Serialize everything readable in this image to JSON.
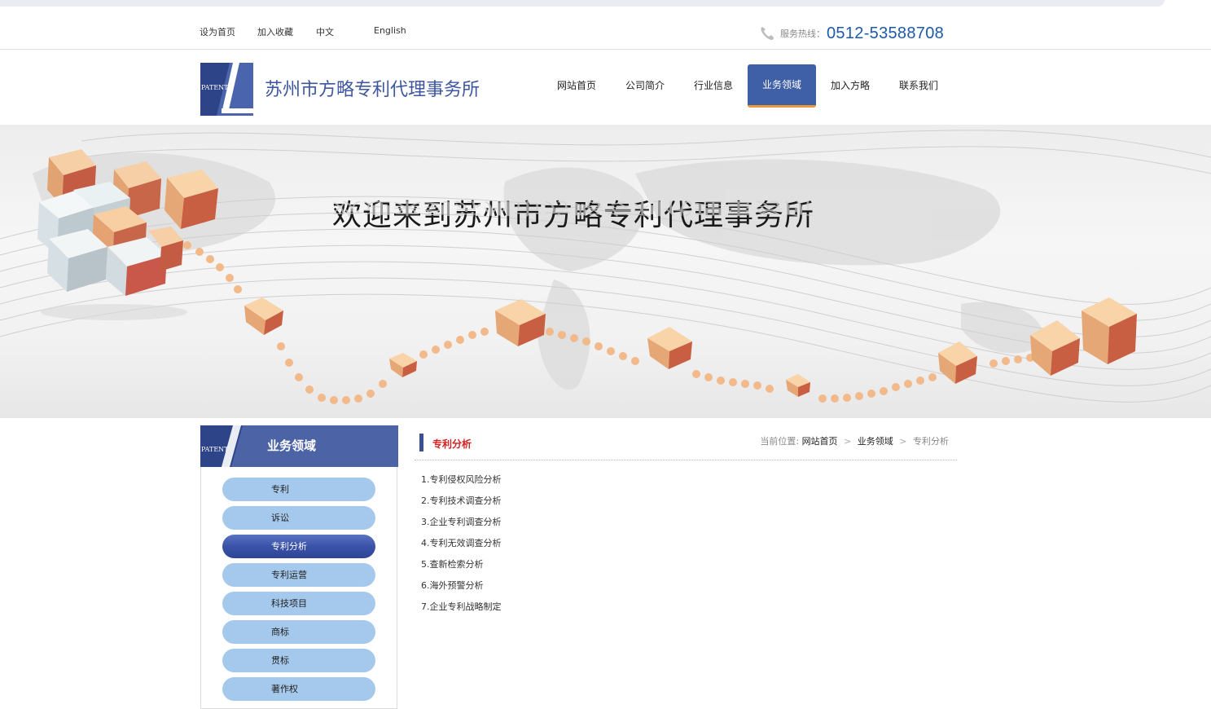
{
  "top_links": [
    "设为首页",
    "加入收藏",
    "中文",
    "English"
  ],
  "hotline": {
    "label": "服务热线：",
    "number": "0512-53588708"
  },
  "site_name": "苏州市方略专利代理事务所",
  "logo_text": "PATENT",
  "nav": [
    {
      "label": "网站首页"
    },
    {
      "label": "公司简介"
    },
    {
      "label": "行业信息"
    },
    {
      "label": "业务领域",
      "active": true
    },
    {
      "label": "加入方略"
    },
    {
      "label": "联系我们"
    }
  ],
  "banner": {
    "title": "欢迎来到苏州市方略专利代理事务所"
  },
  "sidebar": {
    "title": "业务领域",
    "items": [
      {
        "label": "专利"
      },
      {
        "label": "诉讼"
      },
      {
        "label": "专利分析",
        "active": true
      },
      {
        "label": "专利运营"
      },
      {
        "label": "科技项目"
      },
      {
        "label": "商标"
      },
      {
        "label": "贯标"
      },
      {
        "label": "著作权"
      }
    ]
  },
  "content": {
    "title": "专利分析",
    "breadcrumb": {
      "prefix": "当前位置:",
      "home": "网站首页",
      "section": "业务领域",
      "current": "专利分析"
    },
    "items": [
      "1.专利侵权风险分析",
      "2.专利技术调查分析",
      "3.企业专利调查分析",
      "4.专利无效调查分析",
      "5.查新检索分析",
      "6.海外预警分析",
      "7.企业专利战略制定"
    ]
  },
  "colors": {
    "brand_blue": "#3f5fa6",
    "accent_orange": "#e99a3a",
    "title_red": "#d32020",
    "hotline_blue": "#1c5aa9",
    "pill_blue": "#a5c9ec"
  }
}
